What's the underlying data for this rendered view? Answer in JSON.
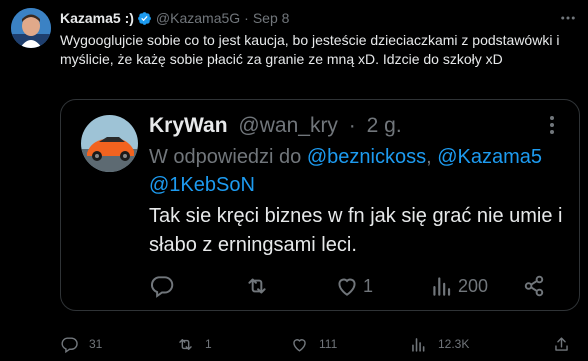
{
  "tweet": {
    "author_name": "Kazama5 :)",
    "handle": "@Kazama5G",
    "separator": "·",
    "date": "Sep 8",
    "text": "Wygooglujcie sobie co to jest kaucja, bo jesteście dzieciaczkami z podstawówki i myślicie, że każę sobie płacić za granie ze mną xD. Idzcie do szkoły xD",
    "icons": {
      "avatar": "user-avatar",
      "verified": "verified-badge-icon",
      "more": "more-options-icon"
    },
    "colors": {
      "background": "#000000",
      "text": "#e7e9ea",
      "secondary": "#71767b",
      "accent": "#1d9bf0",
      "border": "#2f3336"
    }
  },
  "quote": {
    "author_name": "KryWan",
    "handle": "@wan_kry",
    "separator": "·",
    "date": "2 g.",
    "reply_prefix": "W odpowiedzi do",
    "mentions": [
      "@beznickoss",
      "@Kazama5",
      "@1KebSoN"
    ],
    "mention_separator": ", ",
    "text": "Tak sie kręci biznes w fn jak się grać nie umie i słabo z erningsami leci.",
    "stats": {
      "replies": "",
      "retweets": "",
      "likes": "1",
      "views": "200"
    }
  },
  "actions": {
    "replies": "31",
    "retweets": "1",
    "likes": "111",
    "views": "12.3K"
  }
}
